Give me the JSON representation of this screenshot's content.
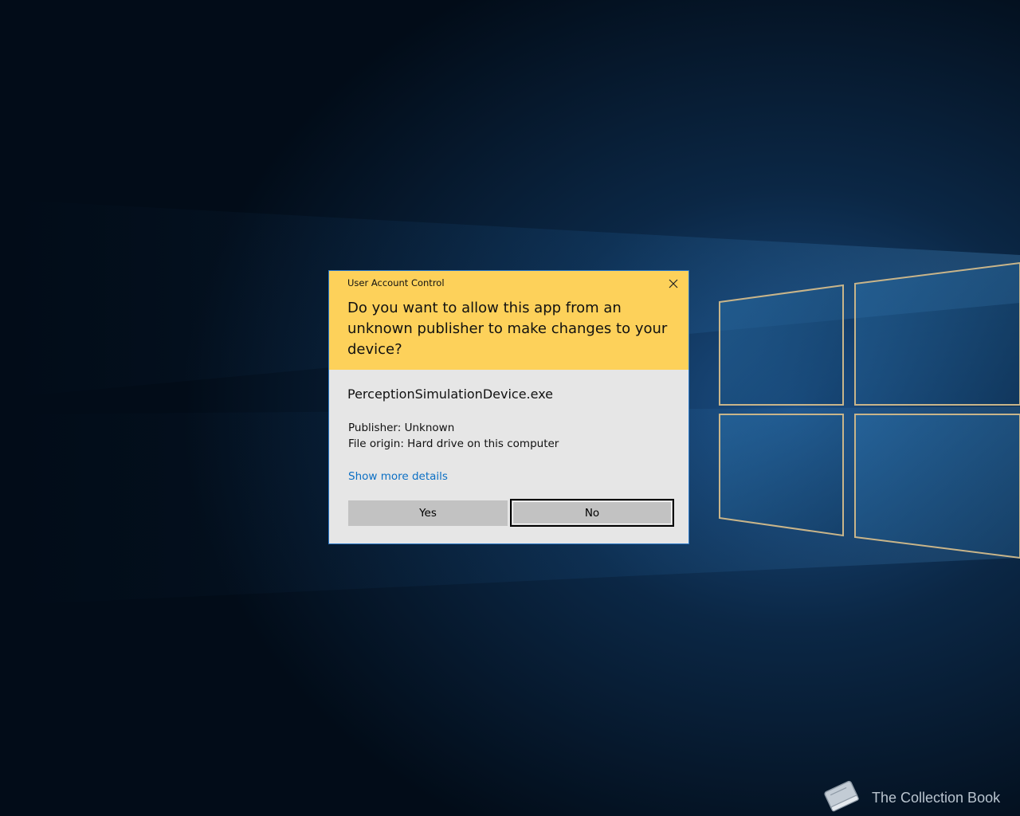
{
  "dialog": {
    "caption": "User Account Control",
    "question": "Do you want to allow this app from an unknown publisher to make changes to your device?",
    "app_name": "PerceptionSimulationDevice.exe",
    "publisher": "Publisher: Unknown",
    "file_origin": "File origin: Hard drive on this computer",
    "details_link": "Show more details",
    "yes_label": "Yes",
    "no_label": "No",
    "close_icon": "close-icon"
  },
  "watermark": {
    "text": "The Collection Book",
    "icon": "book-icon"
  },
  "colors": {
    "header_background": "#fdd15a",
    "dialog_background": "#e6e6e6",
    "link": "#0b6fc4",
    "button": "#c2c2c2",
    "desktop_background": "#02101e"
  }
}
